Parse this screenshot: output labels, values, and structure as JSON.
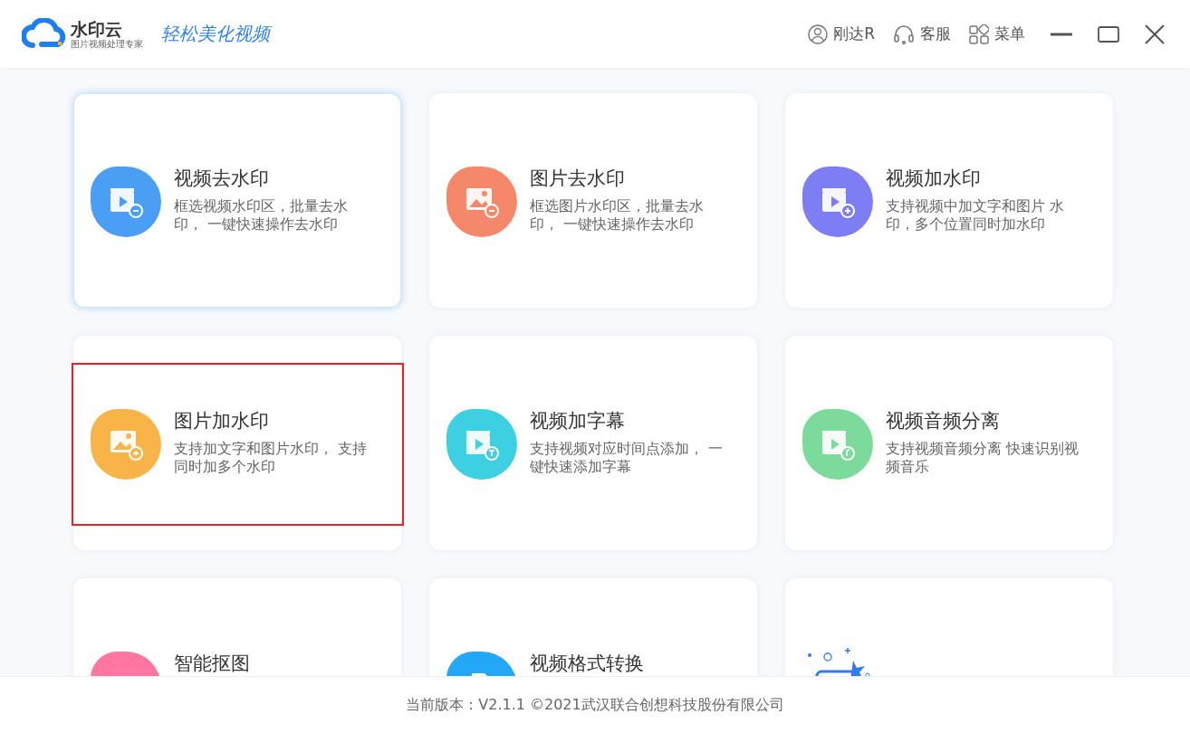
{
  "header": {
    "brand": "水印云",
    "brand_subtitle": "图片视频处理专家",
    "slogan": "轻松美化视频",
    "user": "刚达R",
    "support": "客服",
    "menu": "菜单"
  },
  "cards": [
    {
      "kind": "video-minus",
      "title": "视频去水印",
      "description": "框选视频水印区，批量去水印， 一键快速操作去水印",
      "color": "#4a9ef3",
      "selected": true,
      "outlined": false
    },
    {
      "kind": "image-minus",
      "title": "图片去水印",
      "description": "框选图片水印区，批量去水印， 一键快速操作去水印",
      "color": "#f5886a",
      "selected": false,
      "outlined": false
    },
    {
      "kind": "video-plus",
      "title": "视频加水印",
      "description": "支持视频中加文字和图片 水印，多个位置同时加水印",
      "color": "#7d7ef4",
      "selected": false,
      "outlined": false
    },
    {
      "kind": "image-plus",
      "title": "图片加水印",
      "description": "支持加文字和图片水印， 支持同时加多个水印",
      "color": "#f8b448",
      "selected": false,
      "outlined": true
    },
    {
      "kind": "video-text",
      "title": "视频加字幕",
      "description": "支持视频对应时间点添加， 一键快速添加字幕",
      "color": "#3cd0e2",
      "selected": false,
      "outlined": false
    },
    {
      "kind": "video-music",
      "title": "视频音频分离",
      "description": "支持视频音频分离 快速识别视频音乐",
      "color": "#7cdb9a",
      "selected": false,
      "outlined": false
    },
    {
      "kind": "magic",
      "title": "智能抠图",
      "color": "#ff77a0",
      "selected": false,
      "outlined": false
    },
    {
      "kind": "convert",
      "title": "视频格式转换",
      "color": "#22a8f7",
      "selected": false,
      "outlined": false
    },
    {
      "kind": "illustration",
      "color": "#2f7bf5",
      "selected": false,
      "outlined": false
    }
  ],
  "footer": "当前版本：V2.1.1 ©2021武汉联合创想科技股份有限公司"
}
